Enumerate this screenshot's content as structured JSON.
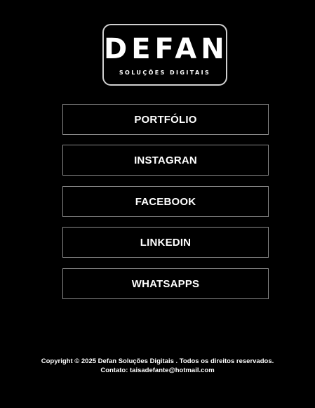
{
  "logo": {
    "wordmark": "DEFAN",
    "tagline": "SOLUÇÕES DIGITAIS"
  },
  "nav": {
    "buttons": [
      {
        "label": "PORTFÓLIO"
      },
      {
        "label": "INSTAGRAN"
      },
      {
        "label": "FACEBOOK"
      },
      {
        "label": "LINKEDIN"
      },
      {
        "label": "WHATSAPPS"
      }
    ]
  },
  "footer": {
    "copyright": "Copyright © 2025 Defan Soluções Digitais . Todos os direitos reservados.",
    "contact": "Contato: taisadefante@hotmail.com"
  },
  "colors": {
    "background": "#000000",
    "text": "#ffffff",
    "border": "#8a8a8a"
  }
}
